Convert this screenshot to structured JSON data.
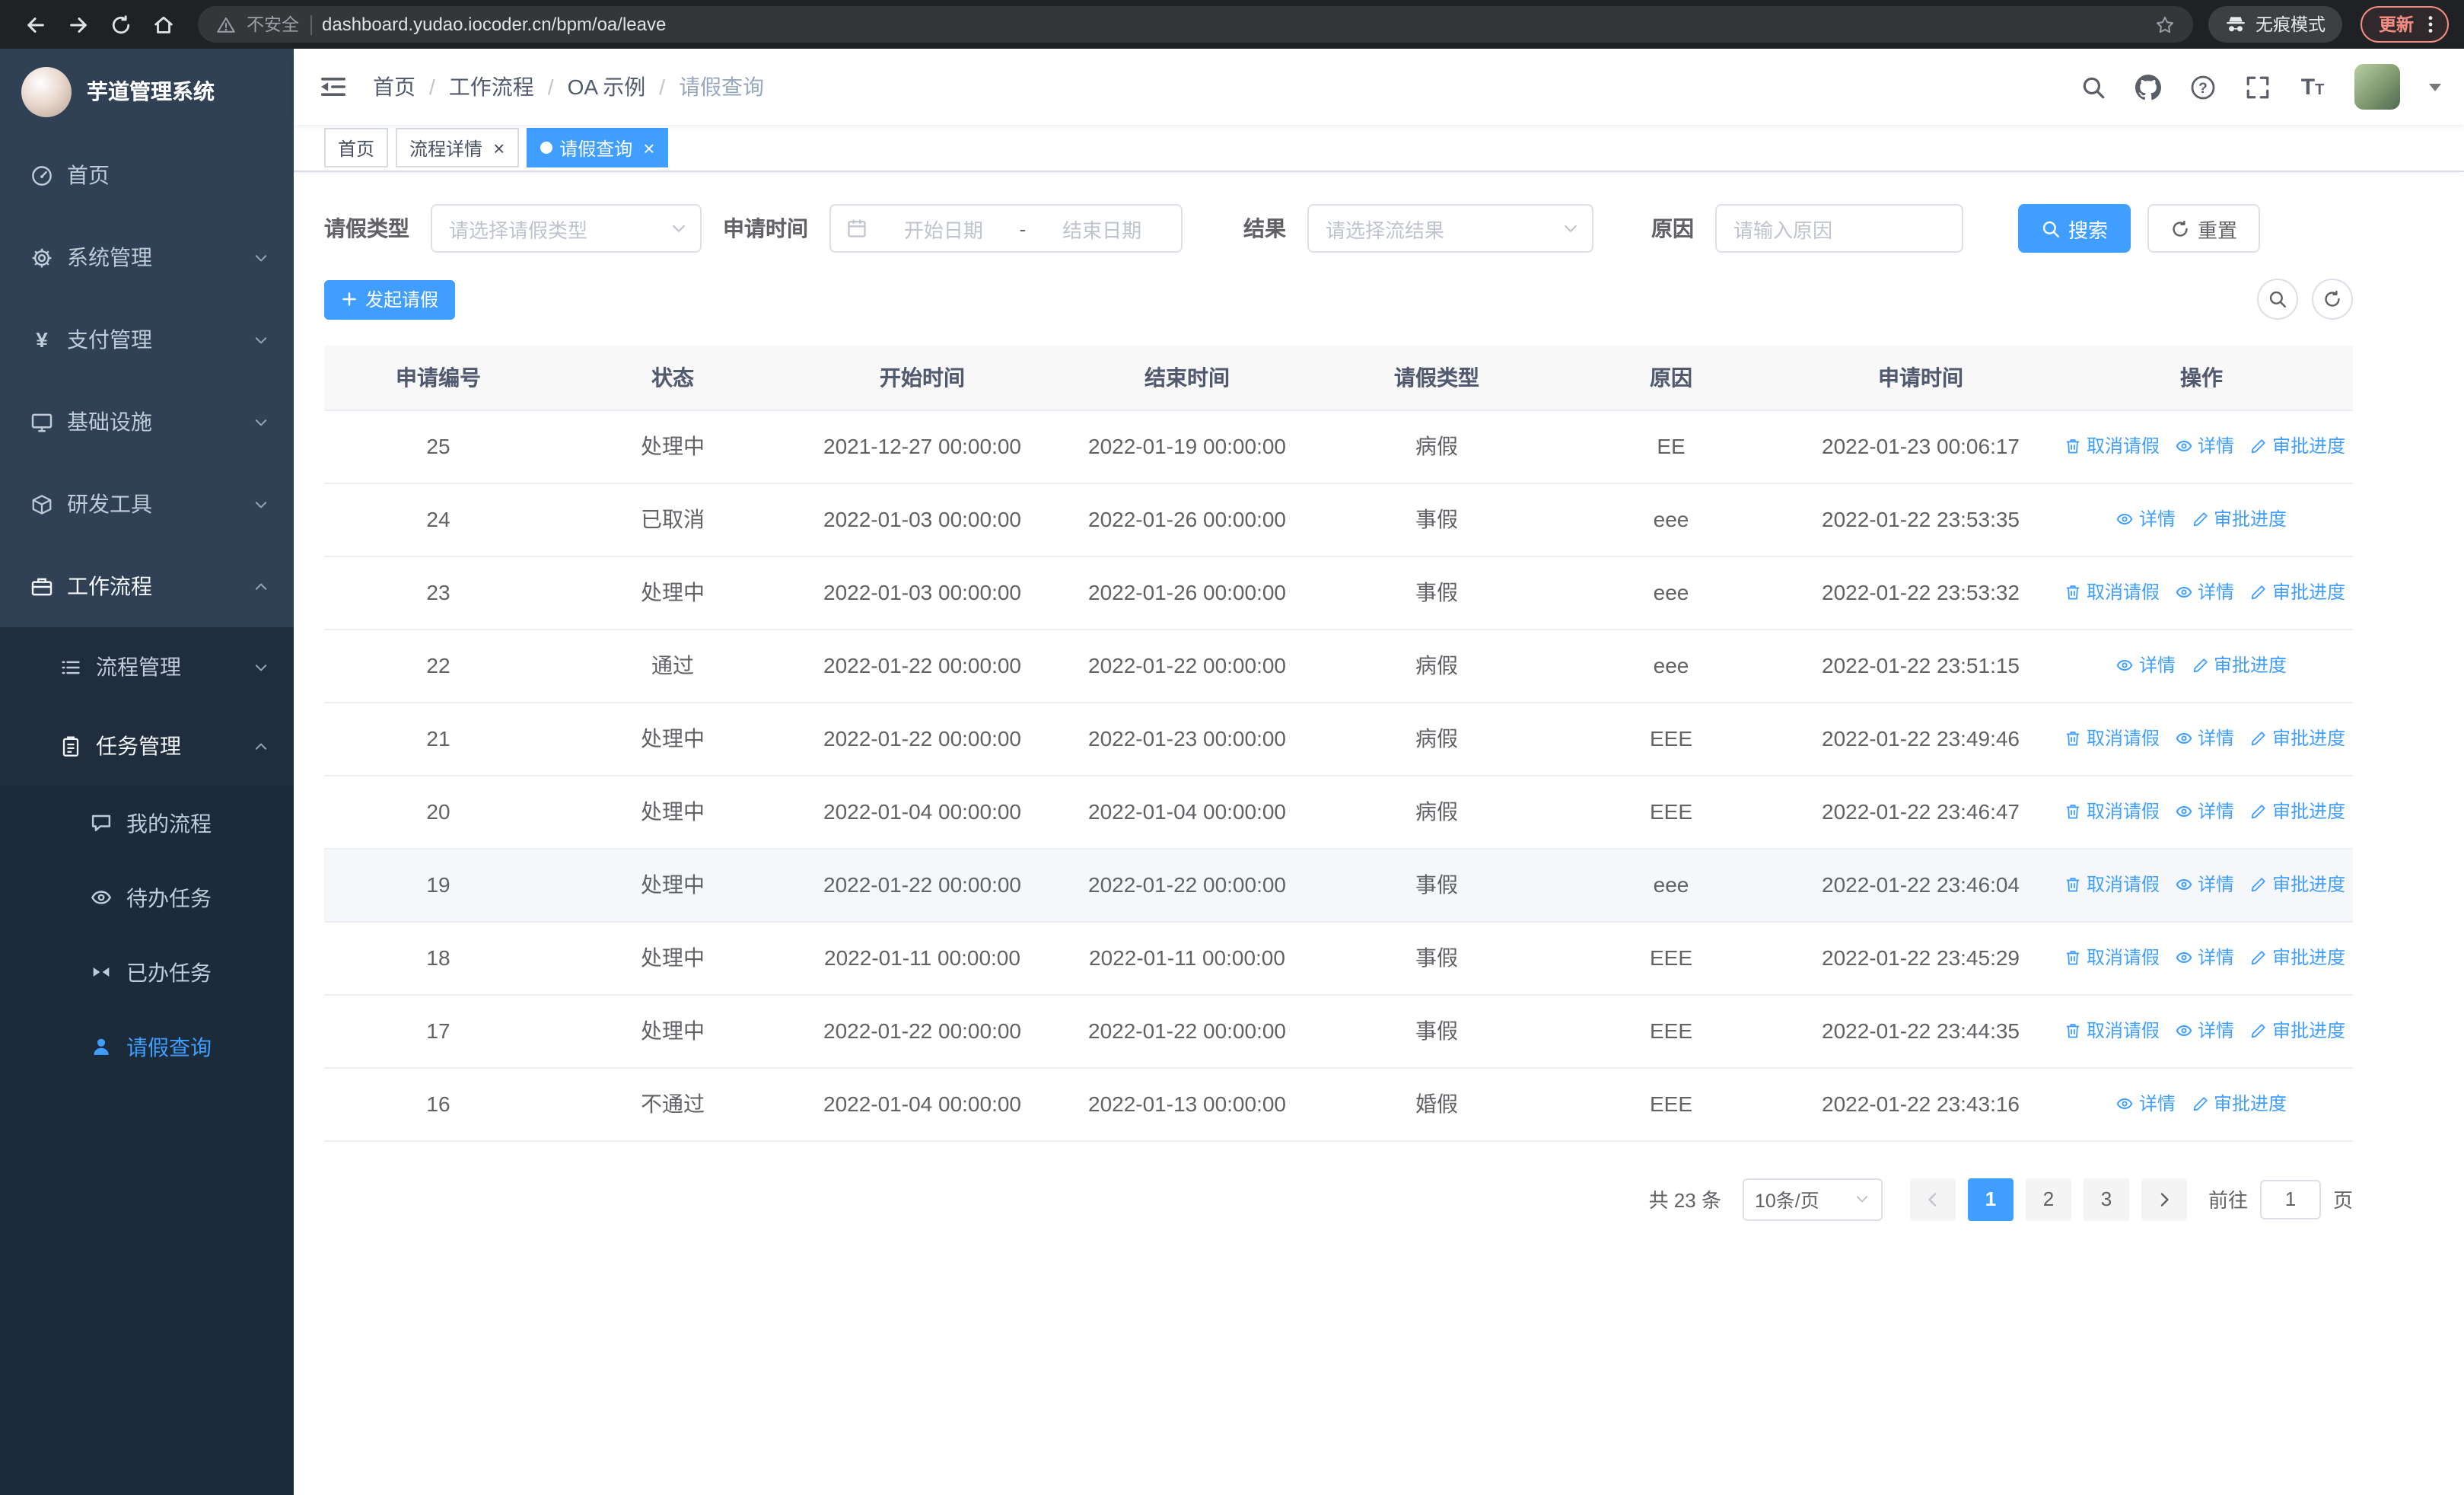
{
  "colors": {
    "primary": "#409eff",
    "sidebar_bg": "#304156",
    "sidebar_submenu_bg": "#1f2d3d",
    "sidebar_active_text": "#409eff",
    "chrome_bg": "#202124",
    "update_chip": "#f28b82",
    "table_header_bg": "#f8f8f9"
  },
  "browser": {
    "security_label": "不安全",
    "url": "dashboard.yudao.iocoder.cn/bpm/oa/leave",
    "incognito_label": "无痕模式",
    "update_label": "更新"
  },
  "sidebar": {
    "logo_title": "芋道管理系统",
    "items": [
      {
        "name": "sidebar-item-home",
        "label": "首页",
        "icon": "dashboard-icon",
        "level": 1
      },
      {
        "name": "sidebar-item-system",
        "label": "系统管理",
        "icon": "gear-icon",
        "level": 1,
        "arrow": "down"
      },
      {
        "name": "sidebar-item-payment",
        "label": "支付管理",
        "icon": "yen-icon",
        "level": 1,
        "arrow": "down"
      },
      {
        "name": "sidebar-item-infra",
        "label": "基础设施",
        "icon": "monitor-icon",
        "level": 1,
        "arrow": "down"
      },
      {
        "name": "sidebar-item-devtools",
        "label": "研发工具",
        "icon": "cube-icon",
        "level": 1,
        "arrow": "down"
      },
      {
        "name": "sidebar-item-workflow",
        "label": "工作流程",
        "icon": "briefcase-icon",
        "level": 1,
        "arrow": "up",
        "open": true
      },
      {
        "name": "sidebar-item-process-mgmt",
        "label": "流程管理",
        "icon": "list-icon",
        "level": 2,
        "arrow": "down"
      },
      {
        "name": "sidebar-item-task-mgmt",
        "label": "任务管理",
        "icon": "clipboard-icon",
        "level": 2,
        "arrow": "up",
        "open": true
      },
      {
        "name": "sidebar-item-my-process",
        "label": "我的流程",
        "icon": "chat-icon",
        "level": 3
      },
      {
        "name": "sidebar-item-todo-tasks",
        "label": "待办任务",
        "icon": "eye-icon",
        "level": 3
      },
      {
        "name": "sidebar-item-done-tasks",
        "label": "已办任务",
        "icon": "bowtie-icon",
        "level": 3
      },
      {
        "name": "sidebar-item-leave-query",
        "label": "请假查询",
        "icon": "user-icon",
        "level": 3,
        "active": true
      }
    ]
  },
  "header": {
    "breadcrumb": [
      "首页",
      "工作流程",
      "OA 示例",
      "请假查询"
    ]
  },
  "tabs": [
    {
      "name": "tab-home",
      "label": "首页",
      "closable": false,
      "active": false
    },
    {
      "name": "tab-process-detail",
      "label": "流程详情",
      "closable": true,
      "active": false
    },
    {
      "name": "tab-leave-query",
      "label": "请假查询",
      "closable": true,
      "active": true
    }
  ],
  "filters": {
    "leave_type": {
      "label": "请假类型",
      "placeholder": "请选择请假类型"
    },
    "apply_time": {
      "label": "申请时间",
      "start_placeholder": "开始日期",
      "separator": "-",
      "end_placeholder": "结束日期"
    },
    "result": {
      "label": "结果",
      "placeholder": "请选择流结果"
    },
    "reason": {
      "label": "原因",
      "placeholder": "请输入原因"
    },
    "search_label": "搜索",
    "reset_label": "重置"
  },
  "toolbar": {
    "create_label": "发起请假"
  },
  "table": {
    "columns": [
      "申请编号",
      "状态",
      "开始时间",
      "结束时间",
      "请假类型",
      "原因",
      "申请时间",
      "操作"
    ],
    "action_defs": {
      "cancel": {
        "name": "cancel-leave-link",
        "icon": "delete-icon",
        "label": "取消请假"
      },
      "detail": {
        "name": "detail-link",
        "icon": "view-icon",
        "label": "详情"
      },
      "progress": {
        "name": "approval-progress-link",
        "icon": "edit-icon",
        "label": "审批进度"
      }
    },
    "rows": [
      {
        "id": "25",
        "status": "处理中",
        "start_time": "2021-12-27 00:00:00",
        "end_time": "2022-01-19 00:00:00",
        "leave_type": "病假",
        "reason": "EE",
        "apply_time": "2022-01-23 00:06:17",
        "actions": [
          "cancel",
          "detail",
          "progress"
        ]
      },
      {
        "id": "24",
        "status": "已取消",
        "start_time": "2022-01-03 00:00:00",
        "end_time": "2022-01-26 00:00:00",
        "leave_type": "事假",
        "reason": "eee",
        "apply_time": "2022-01-22 23:53:35",
        "actions": [
          "detail",
          "progress"
        ]
      },
      {
        "id": "23",
        "status": "处理中",
        "start_time": "2022-01-03 00:00:00",
        "end_time": "2022-01-26 00:00:00",
        "leave_type": "事假",
        "reason": "eee",
        "apply_time": "2022-01-22 23:53:32",
        "actions": [
          "cancel",
          "detail",
          "progress"
        ]
      },
      {
        "id": "22",
        "status": "通过",
        "start_time": "2022-01-22 00:00:00",
        "end_time": "2022-01-22 00:00:00",
        "leave_type": "病假",
        "reason": "eee",
        "apply_time": "2022-01-22 23:51:15",
        "actions": [
          "detail",
          "progress"
        ]
      },
      {
        "id": "21",
        "status": "处理中",
        "start_time": "2022-01-22 00:00:00",
        "end_time": "2022-01-23 00:00:00",
        "leave_type": "病假",
        "reason": "EEE",
        "apply_time": "2022-01-22 23:49:46",
        "actions": [
          "cancel",
          "detail",
          "progress"
        ]
      },
      {
        "id": "20",
        "status": "处理中",
        "start_time": "2022-01-04 00:00:00",
        "end_time": "2022-01-04 00:00:00",
        "leave_type": "病假",
        "reason": "EEE",
        "apply_time": "2022-01-22 23:46:47",
        "actions": [
          "cancel",
          "detail",
          "progress"
        ]
      },
      {
        "id": "19",
        "status": "处理中",
        "start_time": "2022-01-22 00:00:00",
        "end_time": "2022-01-22 00:00:00",
        "leave_type": "事假",
        "reason": "eee",
        "apply_time": "2022-01-22 23:46:04",
        "actions": [
          "cancel",
          "detail",
          "progress"
        ],
        "highlighted": true
      },
      {
        "id": "18",
        "status": "处理中",
        "start_time": "2022-01-11 00:00:00",
        "end_time": "2022-01-11 00:00:00",
        "leave_type": "事假",
        "reason": "EEE",
        "apply_time": "2022-01-22 23:45:29",
        "actions": [
          "cancel",
          "detail",
          "progress"
        ]
      },
      {
        "id": "17",
        "status": "处理中",
        "start_time": "2022-01-22 00:00:00",
        "end_time": "2022-01-22 00:00:00",
        "leave_type": "事假",
        "reason": "EEE",
        "apply_time": "2022-01-22 23:44:35",
        "actions": [
          "cancel",
          "detail",
          "progress"
        ]
      },
      {
        "id": "16",
        "status": "不通过",
        "start_time": "2022-01-04 00:00:00",
        "end_time": "2022-01-13 00:00:00",
        "leave_type": "婚假",
        "reason": "EEE",
        "apply_time": "2022-01-22 23:43:16",
        "actions": [
          "detail",
          "progress"
        ]
      }
    ]
  },
  "pagination": {
    "total_label": "共 23 条",
    "page_size": "10条/页",
    "pages": [
      "1",
      "2",
      "3"
    ],
    "active_page": "1",
    "goto_label": "前往",
    "goto_value": "1",
    "page_label": "页"
  }
}
